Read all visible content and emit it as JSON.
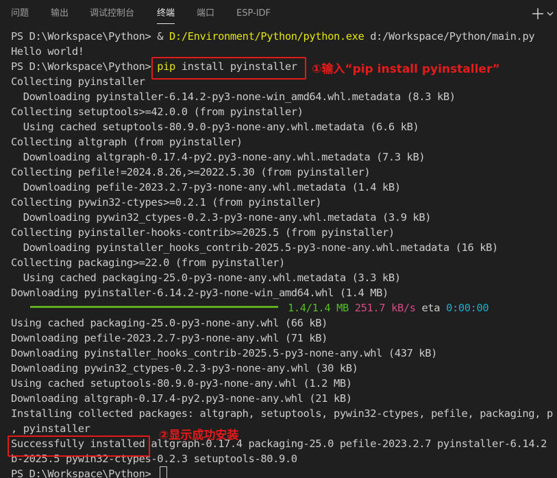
{
  "tabs": [
    {
      "label": "问题"
    },
    {
      "label": "输出"
    },
    {
      "label": "调试控制台"
    },
    {
      "label": "终端"
    },
    {
      "label": "端口"
    },
    {
      "label": "ESP-IDF"
    }
  ],
  "tab_actions": {
    "add_icon": "plus-icon",
    "more_icon": "chevron-down-icon"
  },
  "colors": {
    "background": "#1f1f1f",
    "text": "#cccccc",
    "path": "#e5e510",
    "progress": "#5faf1f",
    "speed": "#d64b85",
    "eta": "#15b1c8",
    "annotation": "#e51a1a"
  },
  "terminal": {
    "line1": {
      "prompt": "PS D:\\Workspace\\Python> ",
      "amp": "& ",
      "exe": "D:/Environment/Python/python.exe",
      "args": " d:/Workspace/Python/main.py"
    },
    "line2": "Hello world!",
    "line3": {
      "prompt": "PS D:\\Workspace\\Python> ",
      "cmd": "pip",
      "args": " install pyinstaller"
    },
    "lines_a": [
      "Collecting pyinstaller",
      "  Downloading pyinstaller-6.14.2-py3-none-win_amd64.whl.metadata (8.3 kB)",
      "Collecting setuptools>=42.0.0 (from pyinstaller)",
      "  Using cached setuptools-80.9.0-py3-none-any.whl.metadata (6.6 kB)",
      "Collecting altgraph (from pyinstaller)",
      "  Downloading altgraph-0.17.4-py2.py3-none-any.whl.metadata (7.3 kB)",
      "Collecting pefile!=2024.8.26,>=2022.5.30 (from pyinstaller)",
      "  Downloading pefile-2023.2.7-py3-none-any.whl.metadata (1.4 kB)",
      "Collecting pywin32-ctypes>=0.2.1 (from pyinstaller)",
      "  Downloading pywin32_ctypes-0.2.3-py3-none-any.whl.metadata (3.9 kB)",
      "Collecting pyinstaller-hooks-contrib>=2025.5 (from pyinstaller)",
      "  Downloading pyinstaller_hooks_contrib-2025.5-py3-none-any.whl.metadata (16 kB)",
      "Collecting packaging>=22.0 (from pyinstaller)",
      "  Using cached packaging-25.0-py3-none-any.whl.metadata (3.3 kB)",
      "Downloading pyinstaller-6.14.2-py3-none-win_amd64.whl (1.4 MB)"
    ],
    "progress": {
      "fraction": 1.0,
      "size": "1.4/1.4 MB",
      "speed": "251.7 kB/s",
      "eta_label": "eta",
      "eta": "0:00:00"
    },
    "lines_b": [
      "Using cached packaging-25.0-py3-none-any.whl (66 kB)",
      "Downloading pefile-2023.2.7-py3-none-any.whl (71 kB)",
      "Downloading pyinstaller_hooks_contrib-2025.5-py3-none-any.whl (437 kB)",
      "Downloading pywin32_ctypes-0.2.3-py3-none-any.whl (30 kB)",
      "Using cached setuptools-80.9.0-py3-none-any.whl (1.2 MB)",
      "Downloading altgraph-0.17.4-py2.py3-none-any.whl (21 kB)",
      "Installing collected packages: altgraph, setuptools, pywin32-ctypes, pefile, packaging, p",
      ", pyinstaller"
    ],
    "success_line": {
      "highlight": "Successfully installed",
      "rest": " altgraph-0.17.4 packaging-25.0 pefile-2023.2.7 pyinstaller-6.14.2"
    },
    "wrap_line": "b-2025.5 pywin32-ctypes-0.2.3 setuptools-80.9.0",
    "final_prompt": "PS D:\\Workspace\\Python> "
  },
  "annotations": {
    "step1": "①输入“pip install pyinstaller”",
    "step2": "②显示成功安装"
  }
}
